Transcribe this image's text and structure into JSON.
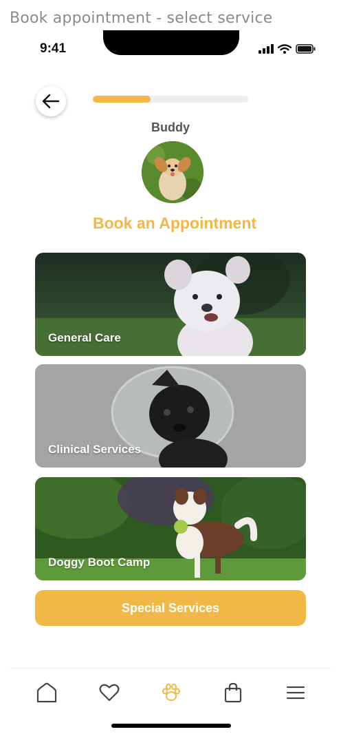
{
  "caption": "Book appointment - select service",
  "status_bar": {
    "time": "9:41",
    "icons": [
      "signal-icon",
      "wifi-icon",
      "battery-icon"
    ]
  },
  "header": {
    "back_icon": "arrow-left-icon",
    "progress_fraction": 0.37
  },
  "pet": {
    "name": "Buddy",
    "avatar": "dog-photo"
  },
  "title": "Book an Appointment",
  "services": [
    {
      "label": "General Care"
    },
    {
      "label": "Clinical Services"
    },
    {
      "label": "Doggy Boot Camp"
    }
  ],
  "special_button": "Special Services",
  "bottom_nav": [
    {
      "icon": "home-icon",
      "active": false
    },
    {
      "icon": "heart-icon",
      "active": false
    },
    {
      "icon": "paw-icon",
      "active": true
    },
    {
      "icon": "shopping-bag-icon",
      "active": false
    },
    {
      "icon": "menu-icon",
      "active": false
    }
  ],
  "colors": {
    "accent": "#f2b846",
    "nav_icon": "#444444",
    "progress_track": "#efefef"
  }
}
